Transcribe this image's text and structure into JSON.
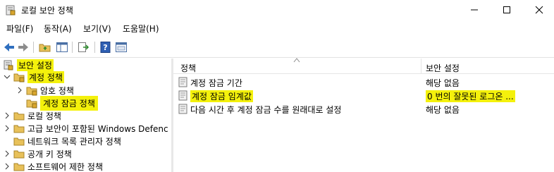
{
  "window": {
    "title": "로컬 보안 정책",
    "app_icon": "security-policy-icon"
  },
  "menu": [
    "파일(F)",
    "동작(A)",
    "보기(V)",
    "도움말(H)"
  ],
  "tree": {
    "root": "보안 설정",
    "account_policies": "계정 정책",
    "password_policy": "암호 정책",
    "account_lockout_policy": "계정 잠금 정책",
    "local_policies": "로컬 정책",
    "advanced_firewall": "고급 보안이 포함된 Windows Defenc",
    "network_list_manager": "네트워크 목록 관리자 정책",
    "public_key_policies": "공개 키 정책",
    "software_restriction": "소프트웨어 제한 정책"
  },
  "list": {
    "col_policy": "정책",
    "col_setting": "보안 설정",
    "rows": [
      {
        "name": "계정 잠금 기간",
        "value": "해당 없음"
      },
      {
        "name": "계정 잠금 임계값",
        "value": "0 번의 잘못된 로그온 ..."
      },
      {
        "name": "다음 시간 후 계정 잠금 수를 원래대로 설정",
        "value": "해당 없음"
      }
    ]
  },
  "colors": {
    "highlight": "#f4f10c",
    "folder": "#e8c15a"
  }
}
